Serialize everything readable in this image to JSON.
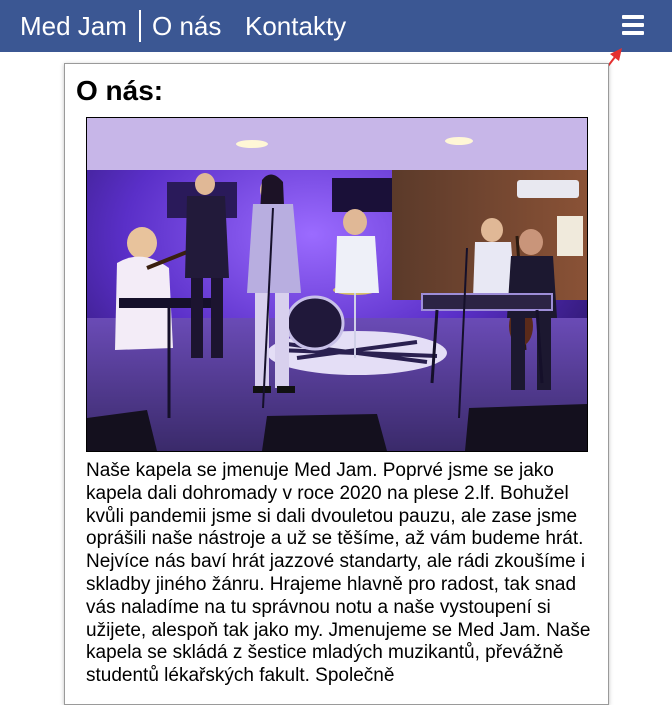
{
  "nav": {
    "brand": "Med Jam",
    "links": [
      "O nás",
      "Kontakty"
    ],
    "menu_icon": "hamburger-menu-icon",
    "background_color": "#3b5793",
    "annotation_color": "#e53030"
  },
  "main": {
    "title": "O nás:",
    "photo_subject": "band performing on stage",
    "text": "Naše kapela se jmenuje Med Jam. Poprvé jsme se jako kapela dali dohromady v roce 2020 na plese 2.lf. Bohužel kvůli pandemii jsme si dali dvouletou pauzu, ale zase jsme oprášili naše nástroje a už se těšíme, až vám budeme hrát. Nejvíce nás baví hrát jazzové standarty, ale rádi zkoušíme i skladby jiného žánru. Hrajeme hlavně pro radost, tak snad vás naladíme na tu správnou notu a naše vystoupení si užijete, alespoň tak jako my. Jmenujeme se Med Jam. Naše kapela se skládá z šestice mladých muzikantů, převážně studentů lékařských fakult. Společně"
  }
}
